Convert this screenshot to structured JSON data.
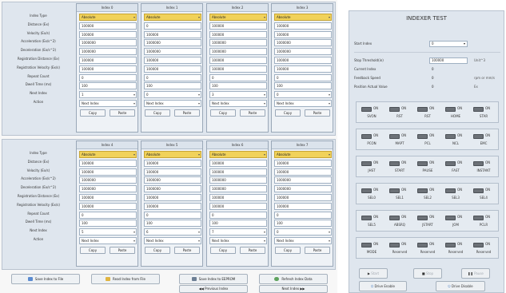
{
  "editor": {
    "row_labels": [
      "Index Type",
      "Distance (Ex)",
      "Velocity (Ex/s)",
      "Acceleration (Ex/s^2)",
      "Deceleration (Ex/s^2)",
      "Registration Distance (Ex)",
      "Registration Velocity (Ex/s)",
      "Repeat Count",
      "Dwell Time (ms)",
      "Next Index",
      "Action"
    ],
    "top_panels": [
      {
        "title": "Index 0",
        "type": "Absolute",
        "values": [
          "100000",
          "100000",
          "1000000",
          "1000000",
          "100000",
          "100000",
          "0",
          "100"
        ],
        "next": "1",
        "action": "Next Index"
      },
      {
        "title": "Index 1",
        "type": "Absolute",
        "values": [
          "0",
          "100000",
          "1000000",
          "1000000",
          "100000",
          "100000",
          "0",
          "100"
        ],
        "next": "0",
        "action": "Next Index"
      },
      {
        "title": "Index 2",
        "type": "Absolute",
        "values": [
          "100000",
          "100000",
          "1000000",
          "1000000",
          "100000",
          "100000",
          "0",
          "100"
        ],
        "next": "3",
        "action": "Next Index"
      },
      {
        "title": "Index 3",
        "type": "Absolute",
        "values": [
          "100000",
          "100000",
          "1000000",
          "1000000",
          "100000",
          "100000",
          "0",
          "100"
        ],
        "next": "0",
        "action": "Next Index"
      }
    ],
    "bottom_panels": [
      {
        "title": "Index 4",
        "type": "Absolute",
        "values": [
          "100000",
          "100000",
          "1000000",
          "1000000",
          "100000",
          "100000",
          "0",
          "100"
        ],
        "next": "5",
        "action": "Next Index"
      },
      {
        "title": "Index 5",
        "type": "Absolute",
        "values": [
          "100000",
          "100000",
          "1000000",
          "1000000",
          "100000",
          "100000",
          "0",
          "100"
        ],
        "next": "6",
        "action": "Next Index"
      },
      {
        "title": "Index 6",
        "type": "Absolute",
        "values": [
          "100000",
          "100000",
          "1000000",
          "1000000",
          "100000",
          "100000",
          "0",
          "100"
        ],
        "next": "7",
        "action": "Next Index"
      },
      {
        "title": "Index 7",
        "type": "Absolute",
        "values": [
          "100000",
          "100000",
          "1000000",
          "1000000",
          "100000",
          "100000",
          "0",
          "100"
        ],
        "next": "0",
        "action": "Next Index"
      }
    ],
    "copy_label": "Copy",
    "paste_label": "Paste",
    "buttons": {
      "save_file": "Save Index to File",
      "read_file": "Read Index from File",
      "save_eeprom": "Save Index to EEPROM",
      "refresh": "Refresh Index Data",
      "prev": "Previous Index",
      "next": "Next Index"
    },
    "colors": {
      "type_highlight": "#f1d25a",
      "panel_bg": "#eef2f6"
    }
  },
  "test": {
    "title": "INDEXER TEST",
    "start_index": {
      "label": "Start Index",
      "value": "0"
    },
    "stop_threshold": {
      "label": "Stop Threshold(in)",
      "value": "100000",
      "unit": "Unit^3"
    },
    "current_index": {
      "label": "Current Index",
      "value": "0"
    },
    "feedback_speed": {
      "label": "Feedback Speed",
      "value": "0",
      "unit": "rpm or mm/s"
    },
    "position_actual": {
      "label": "Position Actual Value",
      "value": "0",
      "unit": "Ex"
    },
    "io_on_label": "ON",
    "io_rows": [
      [
        "SVON",
        "RST",
        "RST",
        "HOME",
        "STAR"
      ],
      [
        "PCON",
        "MAPT",
        "PCL",
        "NCL",
        "EMC"
      ],
      [
        "JHST",
        "START",
        "PAUSE",
        "FAST",
        "INSTANT"
      ],
      [
        "SEL0",
        "SEL1",
        "SEL2",
        "SEL3",
        "SEL4"
      ],
      [
        "SEL5",
        "ABSRQ",
        "JSTART",
        "JOM",
        "PCLR"
      ],
      [
        "MODE",
        "Reserved",
        "Reserved",
        "Reserved",
        "Reserved"
      ]
    ],
    "buttons": {
      "start": "Start",
      "stop": "Stop",
      "pause": "Pause",
      "drive_enable": "Drive Enable",
      "drive_disable": "Drive Disable"
    }
  }
}
